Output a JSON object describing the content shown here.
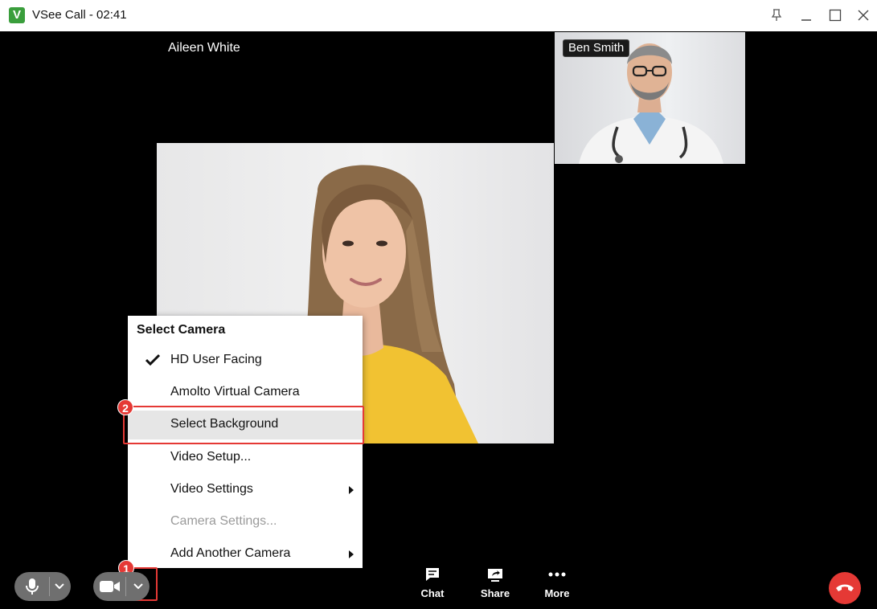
{
  "window": {
    "title": "VSee Call - 02:41",
    "logo_letter": "V"
  },
  "participants": {
    "main_name": "Aileen White",
    "thumb_name": "Ben Smith"
  },
  "camera_menu": {
    "header": "Select Camera",
    "items": [
      {
        "label": "HD User Facing",
        "checked": true
      },
      {
        "label": "Amolto Virtual Camera"
      },
      {
        "label": "Select Background",
        "highlighted": true
      },
      {
        "label": "Video Setup..."
      },
      {
        "label": "Video Settings",
        "submenu": true
      },
      {
        "label": "Camera Settings...",
        "disabled": true
      },
      {
        "label": "Add Another Camera",
        "submenu": true
      }
    ]
  },
  "toolbar": {
    "chat": "Chat",
    "share": "Share",
    "more": "More"
  },
  "annotations": {
    "step1": "1",
    "step2": "2",
    "highlight_color": "#e53935"
  },
  "colors": {
    "brand": "#3a9e3c",
    "hangup": "#e53935"
  }
}
